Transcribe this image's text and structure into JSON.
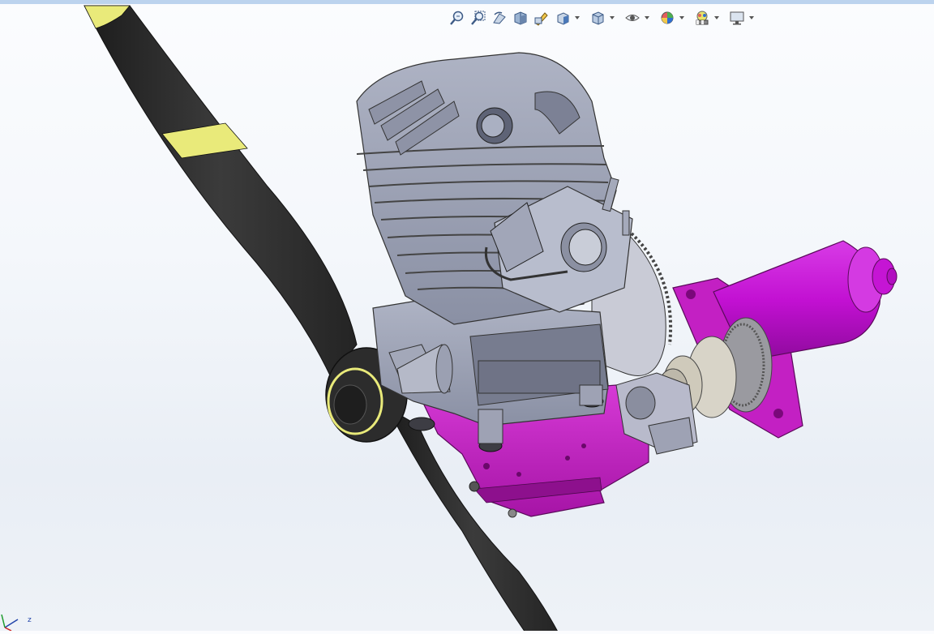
{
  "window": {
    "top_border_color": "#bcd3ee"
  },
  "heads_up_toolbar": {
    "buttons": [
      {
        "id": "zoom-to-fit",
        "icon": "zoom-to-fit-icon",
        "dropdown": false
      },
      {
        "id": "zoom-to-area",
        "icon": "zoom-to-area-icon",
        "dropdown": false
      },
      {
        "id": "previous-view",
        "icon": "previous-view-icon",
        "dropdown": false
      },
      {
        "id": "section-view",
        "icon": "section-view-icon",
        "dropdown": false
      },
      {
        "id": "dynamic-annotation",
        "icon": "dynamic-annotation-icon",
        "dropdown": false
      },
      {
        "id": "view-orientation",
        "icon": "view-orientation-icon",
        "dropdown": true
      },
      {
        "id": "display-style",
        "icon": "display-style-icon",
        "dropdown": true
      },
      {
        "id": "hide-show-items",
        "icon": "hide-show-eye-icon",
        "dropdown": true
      },
      {
        "id": "edit-appearance",
        "icon": "edit-appearance-icon",
        "dropdown": true
      },
      {
        "id": "apply-scene",
        "icon": "apply-scene-icon",
        "dropdown": true
      },
      {
        "id": "view-settings",
        "icon": "view-settings-monitor-icon",
        "dropdown": true
      }
    ]
  },
  "model": {
    "colors": {
      "propeller": "#2e2e2e",
      "propeller_stripe": "#e9ea7a",
      "engine_body": "#9aa0b3",
      "engine_dark": "#6e7386",
      "mount_plate": "#c622c6",
      "starter_motor": "#c210d2",
      "gear": "#b8b8bc"
    }
  },
  "triad": {
    "axis_label": "z"
  }
}
